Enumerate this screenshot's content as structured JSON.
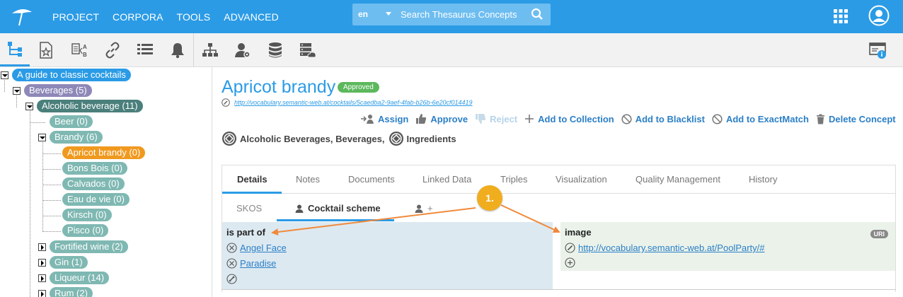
{
  "topbar": {
    "menu": [
      "PROJECT",
      "CORPORA",
      "TOOLS",
      "ADVANCED"
    ],
    "search": {
      "lang": "en",
      "placeholder": "Search Thesaurus Concepts"
    }
  },
  "tree": {
    "nodes": [
      {
        "label": "A guide to classic cocktails",
        "color": "#2b9be6"
      },
      {
        "label": "Beverages (5)",
        "color": "#8e88b8"
      },
      {
        "label": "Alcoholic beverage (11)",
        "color": "#4a7f7b"
      },
      {
        "label": "Beer (0)",
        "color": "#7fb8b2"
      },
      {
        "label": "Brandy (6)",
        "color": "#7fb8b2"
      },
      {
        "label": "Apricot brandy (0)",
        "color": "#f0991e"
      },
      {
        "label": "Bons Bois (0)",
        "color": "#7fb8b2"
      },
      {
        "label": "Calvados (0)",
        "color": "#7fb8b2"
      },
      {
        "label": "Eau de vie (0)",
        "color": "#7fb8b2"
      },
      {
        "label": "Kirsch (0)",
        "color": "#7fb8b2"
      },
      {
        "label": "Pisco (0)",
        "color": "#7fb8b2"
      },
      {
        "label": "Fortified wine (2)",
        "color": "#7fb8b2"
      },
      {
        "label": "Gin (1)",
        "color": "#7fb8b2"
      },
      {
        "label": "Liqueur (14)",
        "color": "#7fb8b2"
      },
      {
        "label": "Rum (2)",
        "color": "#7fb8b2"
      }
    ]
  },
  "concept": {
    "title": "Apricot brandy",
    "status": "Approved",
    "uri": "http://vocabulary.semantic-web.at/cocktails/5caedba2-9aef-4fab-b26b-6e20cf014419"
  },
  "actions": {
    "assign": "Assign",
    "approve": "Approve",
    "reject": "Reject",
    "collection": "Add to Collection",
    "blacklist": "Add to Blacklist",
    "exactmatch": "Add to ExactMatch",
    "delete": "Delete Concept"
  },
  "schemes": {
    "first": "Alcoholic Beverages, Beverages,",
    "second": "Ingredients"
  },
  "tabs": [
    "Details",
    "Notes",
    "Documents",
    "Linked Data",
    "Triples",
    "Visualization",
    "Quality Management",
    "History"
  ],
  "subtabs": {
    "skos": "SKOS",
    "cocktail": "Cocktail scheme",
    "add": "+"
  },
  "is_part_of": {
    "title": "is part of",
    "items": [
      "Angel Face",
      "Paradise"
    ]
  },
  "image": {
    "title": "image",
    "badge": "URI",
    "value": "http://vocabulary.semantic-web.at/PoolParty/#"
  },
  "callout": "1.",
  "colors": {
    "brand": "#2b9be6",
    "callout": "#f0ad1e",
    "arrow": "#f08a3c"
  }
}
